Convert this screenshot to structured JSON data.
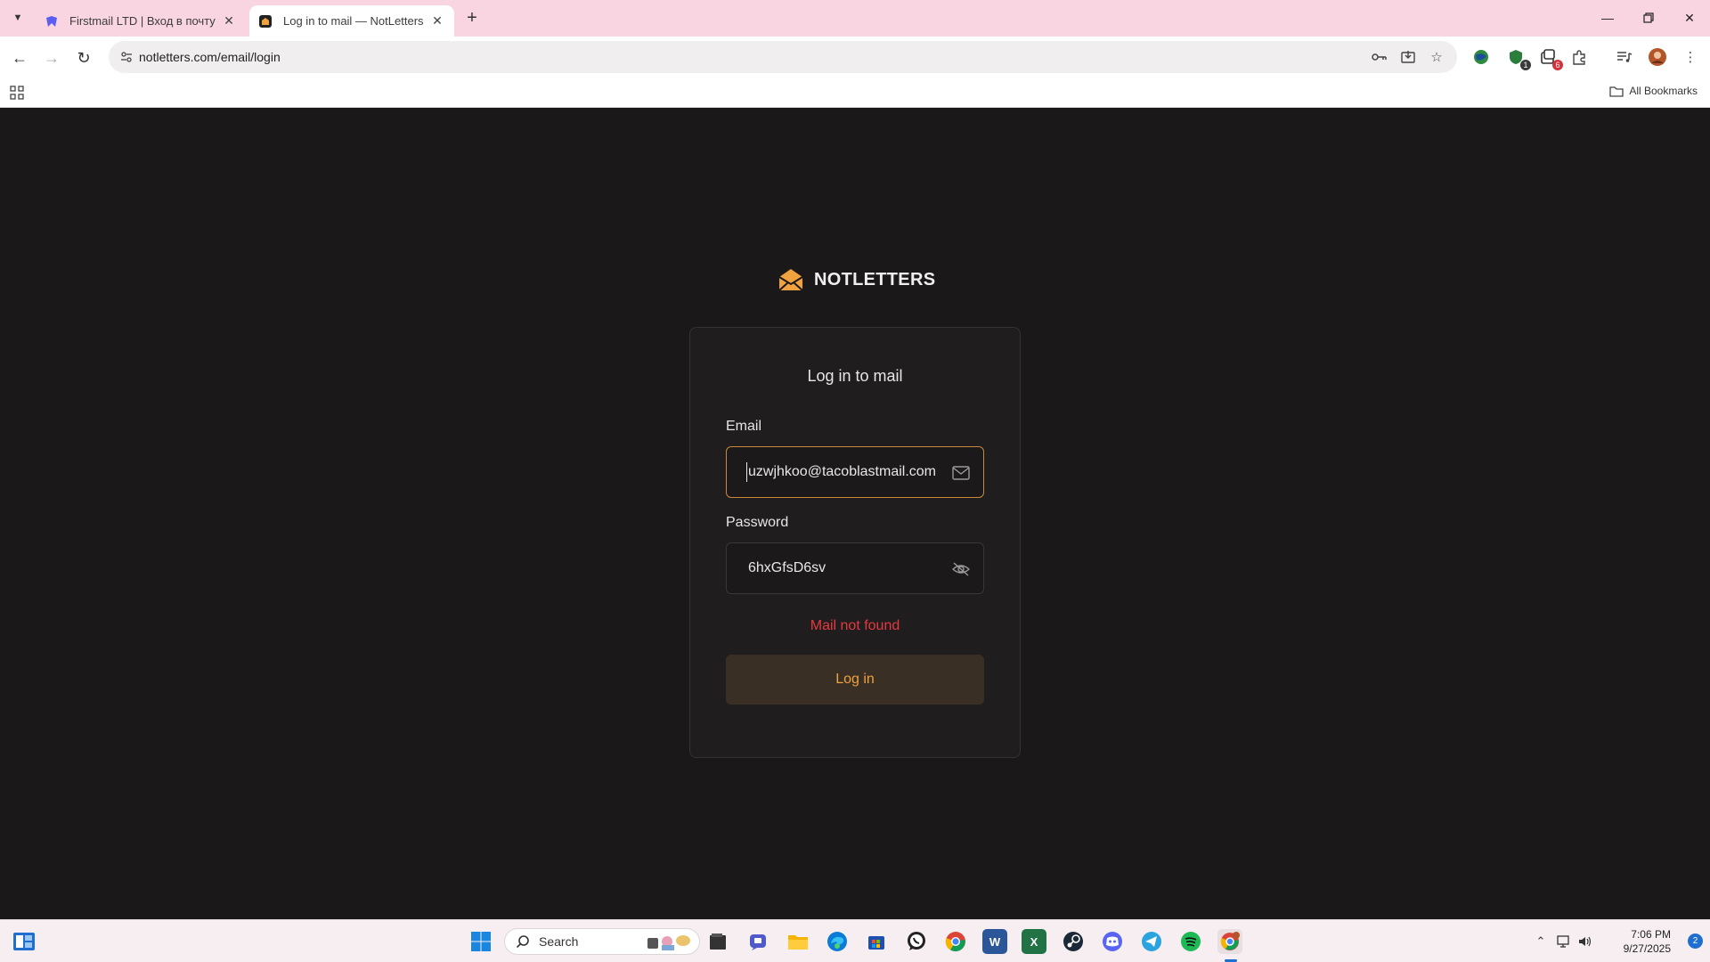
{
  "browser": {
    "tabs": [
      {
        "title": "Firstmail LTD | Вход в почту",
        "active": false
      },
      {
        "title": "Log in to mail — NotLetters",
        "active": true
      }
    ],
    "url": "notletters.com/email/login",
    "bookmarks_all_label": "All Bookmarks",
    "extension_badges": {
      "ext1": "1",
      "ext2": "6"
    }
  },
  "page": {
    "brand": "NOTLETTERS",
    "card_title": "Log in to mail",
    "email": {
      "label": "Email",
      "value": "uzwjhkoo@tacoblastmail.com"
    },
    "password": {
      "label": "Password",
      "value": "6hxGfsD6sv"
    },
    "error": "Mail not found",
    "login_button": "Log in"
  },
  "colors": {
    "accent": "#f0a23e",
    "error": "#e53940",
    "page_bg": "#1a1818",
    "card_bg": "#1f1d1d"
  },
  "taskbar": {
    "search_label": "Search",
    "time": "7:06 PM",
    "date": "9/27/2025",
    "notification_count": "2",
    "apps": [
      "windows-start",
      "file-manager",
      "teams",
      "file-explorer",
      "edge",
      "microsoft-store",
      "whatsapp",
      "chrome",
      "word",
      "excel",
      "steam",
      "discord",
      "telegram",
      "spotify",
      "chrome-profile"
    ]
  }
}
